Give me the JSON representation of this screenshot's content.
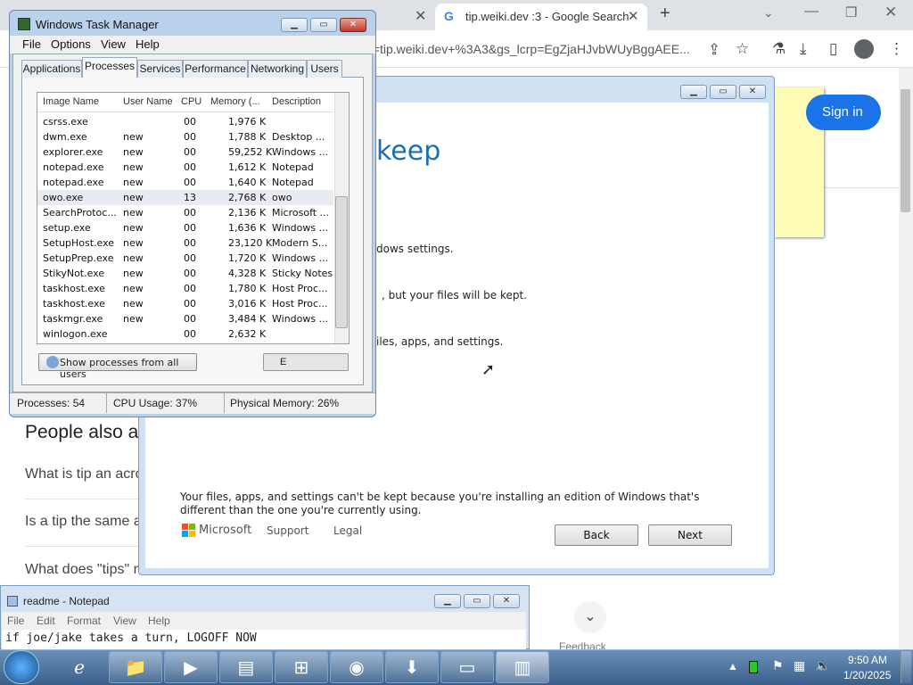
{
  "chrome": {
    "tab_title": "tip.weiki.dev :3 - Google Search",
    "omnibox_text": "q=tip.weiki.dev+%3A3&gs_lcrp=EgZjaHJvbWUyBggAEE...",
    "sign_in": "Sign in"
  },
  "serp": {
    "people_also": "People also a",
    "questions": [
      "What is tip an acro",
      "Is a tip the same a",
      "What does \"tips\" m"
    ],
    "feedback": "Feedback"
  },
  "setup": {
    "heading_fragment": "keep",
    "lines": [
      "dows settings.",
      ", but your files will be kept.",
      "iles, apps, and settings."
    ],
    "warning": "Your files, apps, and settings can't be kept because you're installing an edition of Windows that's different than the one you're currently using.",
    "brand": "Microsoft",
    "support": "Support",
    "legal": "Legal",
    "back": "Back",
    "next": "Next"
  },
  "taskmgr": {
    "title": "Windows Task Manager",
    "menu": [
      "File",
      "Options",
      "View",
      "Help"
    ],
    "tabs": [
      "Applications",
      "Processes",
      "Services",
      "Performance",
      "Networking",
      "Users"
    ],
    "columns": [
      "Image Name",
      "User Name",
      "CPU",
      "Memory (...",
      "Description"
    ],
    "processes": [
      {
        "name": "csrss.exe",
        "user": "",
        "cpu": "00",
        "mem": "1,976 K",
        "desc": ""
      },
      {
        "name": "dwm.exe",
        "user": "new",
        "cpu": "00",
        "mem": "1,788 K",
        "desc": "Desktop ..."
      },
      {
        "name": "explorer.exe",
        "user": "new",
        "cpu": "00",
        "mem": "59,252 K",
        "desc": "Windows ..."
      },
      {
        "name": "notepad.exe",
        "user": "new",
        "cpu": "00",
        "mem": "1,612 K",
        "desc": "Notepad"
      },
      {
        "name": "notepad.exe",
        "user": "new",
        "cpu": "00",
        "mem": "1,640 K",
        "desc": "Notepad"
      },
      {
        "name": "owo.exe",
        "user": "new",
        "cpu": "13",
        "mem": "2,768 K",
        "desc": "owo"
      },
      {
        "name": "SearchProtoc...",
        "user": "new",
        "cpu": "00",
        "mem": "2,136 K",
        "desc": "Microsoft ..."
      },
      {
        "name": "setup.exe",
        "user": "new",
        "cpu": "00",
        "mem": "1,636 K",
        "desc": "Windows ..."
      },
      {
        "name": "SetupHost.exe",
        "user": "new",
        "cpu": "00",
        "mem": "23,120 K",
        "desc": "Modern S..."
      },
      {
        "name": "SetupPrep.exe",
        "user": "new",
        "cpu": "00",
        "mem": "1,720 K",
        "desc": "Windows ..."
      },
      {
        "name": "StikyNot.exe",
        "user": "new",
        "cpu": "00",
        "mem": "4,328 K",
        "desc": "Sticky Notes"
      },
      {
        "name": "taskhost.exe",
        "user": "new",
        "cpu": "00",
        "mem": "1,780 K",
        "desc": "Host Proc..."
      },
      {
        "name": "taskhost.exe",
        "user": "new",
        "cpu": "00",
        "mem": "3,016 K",
        "desc": "Host Proc..."
      },
      {
        "name": "taskmgr.exe",
        "user": "new",
        "cpu": "00",
        "mem": "3,484 K",
        "desc": "Windows ..."
      },
      {
        "name": "winlogon.exe",
        "user": "",
        "cpu": "00",
        "mem": "2,632 K",
        "desc": ""
      }
    ],
    "show_all": "Show processes from all users",
    "end_btn": "E",
    "status": {
      "processes": "Processes: 54",
      "cpu": "CPU Usage: 37%",
      "memory": "Physical Memory: 26%"
    }
  },
  "notepad": {
    "title": "readme - Notepad",
    "menu": [
      "File",
      "Edit",
      "Format",
      "View",
      "Help"
    ],
    "content": "if joe/jake takes a turn, LOGOFF NOW"
  },
  "taskbar": {
    "time": "9:50 AM",
    "date": "1/20/2025"
  }
}
